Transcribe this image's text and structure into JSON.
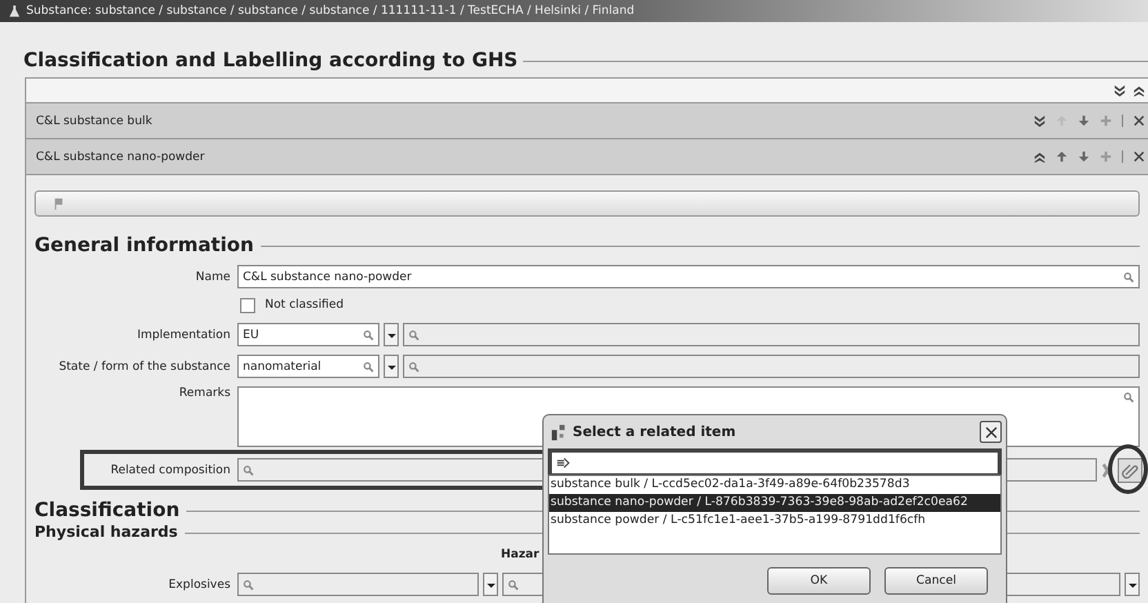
{
  "window": {
    "title": "Substance: substance / substance / substance / substance / 111111-11-1 / TestECHA / Helsinki / Finland"
  },
  "heading": "Classification and Labelling according to GHS",
  "sections": [
    {
      "label": "C&L substance bulk",
      "expanded": false
    },
    {
      "label": "C&L substance nano-powder",
      "expanded": true
    }
  ],
  "general": {
    "heading": "General information",
    "fields": [
      {
        "kind": "text",
        "label": "Name",
        "value": "C&L substance nano-powder"
      },
      {
        "kind": "checkbox",
        "label": "Not classified",
        "checked": false
      },
      {
        "kind": "combo",
        "label": "Implementation",
        "value": "EU"
      },
      {
        "kind": "combo",
        "label": "State / form of the substance",
        "value": "nanomaterial"
      },
      {
        "kind": "textarea",
        "label": "Remarks"
      },
      {
        "kind": "link",
        "label": "Related composition"
      }
    ]
  },
  "classification": {
    "heading": "Classification",
    "subheading": "Physical hazards",
    "column_label": "Hazar",
    "rows": [
      {
        "label": "Explosives"
      }
    ]
  },
  "dialog": {
    "title": "Select a related item",
    "items": [
      {
        "label": "substance bulk / L-ccd5ec02-da1a-3f49-a89e-64f0b23578d3",
        "selected": false
      },
      {
        "label": "substance nano-powder / L-876b3839-7363-39e8-98ab-ad2ef2c0ea62",
        "selected": true
      },
      {
        "label": "substance powder / L-c51fc1e1-aee1-37b5-a199-8791dd1f6cfh",
        "selected": false
      }
    ],
    "buttons": [
      "OK",
      "Cancel"
    ]
  }
}
